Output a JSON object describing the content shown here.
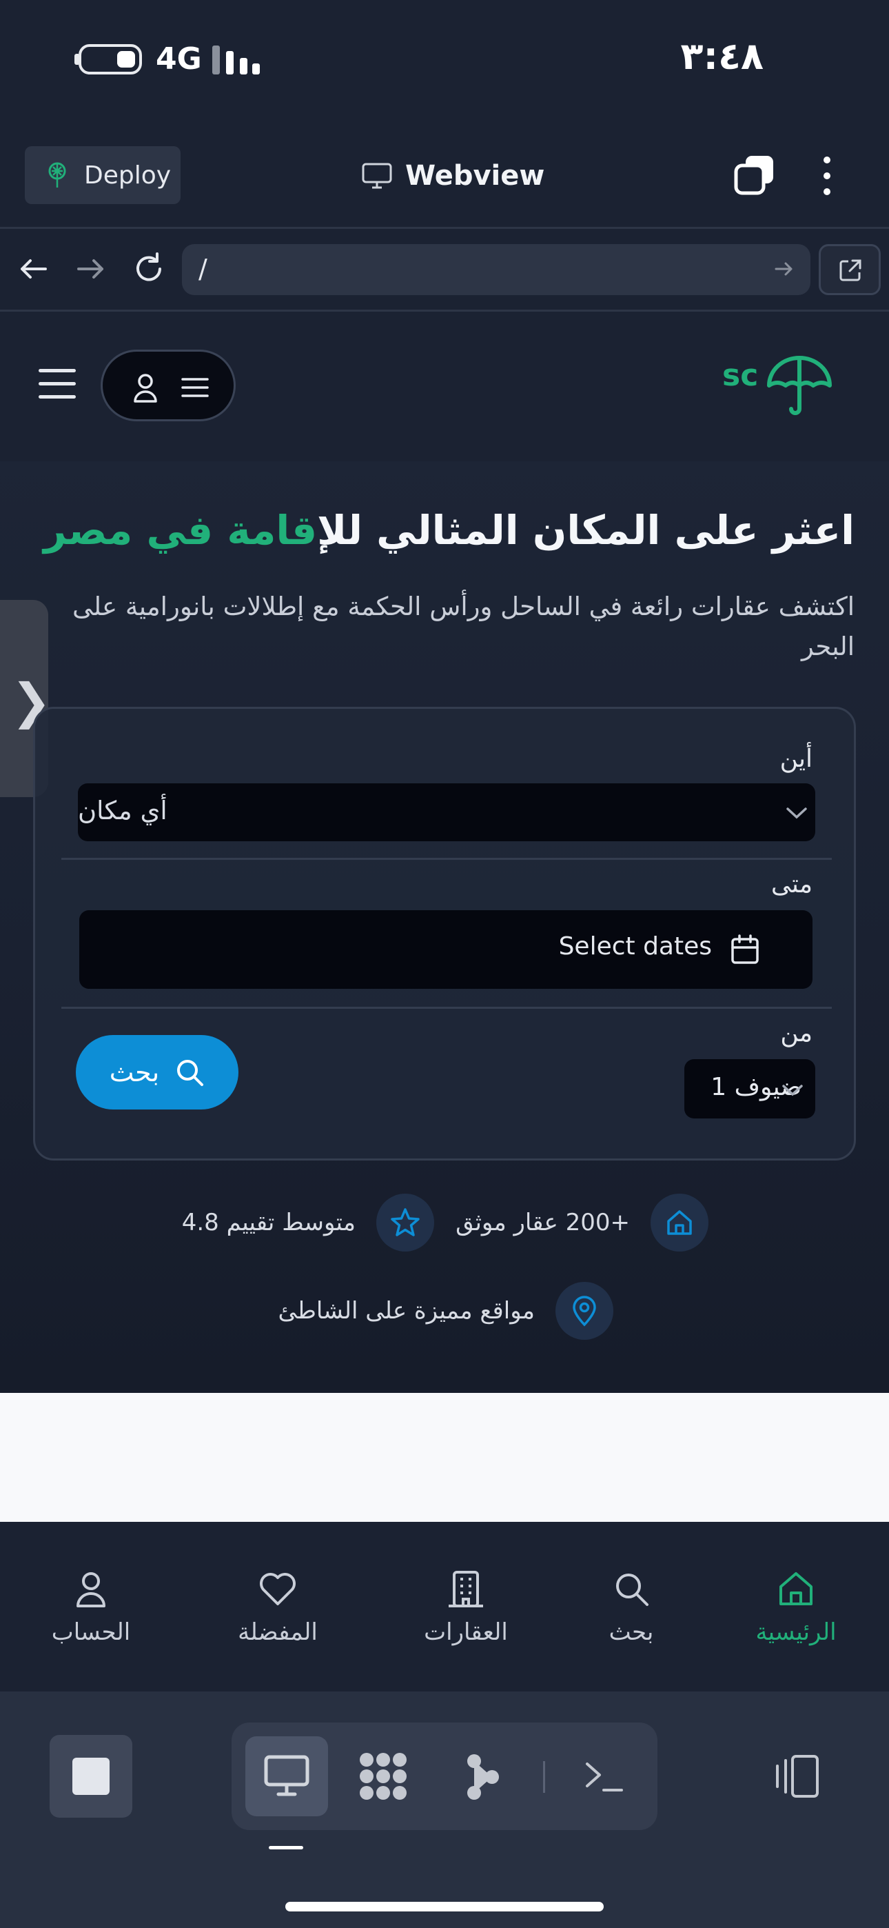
{
  "status_bar": {
    "network": "4G",
    "time": "٣:٤٨"
  },
  "toolbar": {
    "deploy_label": "Deploy",
    "title": "Webview"
  },
  "url_bar": {
    "path": "/"
  },
  "site": {
    "logo_text": "sc",
    "hero_title_plain": "اعثر على المكان المثالي لل",
    "hero_title_accent": "إقامة في مصر",
    "hero_subtitle": "اكتشف عقارات رائعة في الساحل ورأس الحكمة مع إطلالات بانورامية على البحر",
    "side_tab_glyph": "❯",
    "search_card": {
      "where_label": "أين",
      "where_value": "أي مكان",
      "when_label": "متى",
      "when_placeholder": "Select dates",
      "who_label": "من",
      "guests_value": "ضيوف 1",
      "search_button": "بحث"
    },
    "stats": [
      {
        "icon": "home-icon",
        "text": "+200 عقار موثق"
      },
      {
        "icon": "star-icon",
        "text": "متوسط تقييم 4.8"
      },
      {
        "icon": "location-pin-icon",
        "text": "مواقع مميزة على الشاطئ"
      }
    ],
    "accent_color": "#21b07a",
    "button_color": "#0d8ed6"
  },
  "bottom_nav": {
    "items": [
      {
        "label": "الرئيسية",
        "icon": "home-icon",
        "active": true
      },
      {
        "label": "بحث",
        "icon": "search-icon",
        "active": false
      },
      {
        "label": "العقارات",
        "icon": "building-icon",
        "active": false
      },
      {
        "label": "المفضلة",
        "icon": "heart-icon",
        "active": false
      },
      {
        "label": "الحساب",
        "icon": "user-icon",
        "active": false
      }
    ]
  },
  "system_bar": {
    "buttons": [
      "stop-icon",
      "monitor-icon",
      "grid-icon",
      "graph-icon",
      "terminal-icon",
      "split-view-icon"
    ]
  }
}
